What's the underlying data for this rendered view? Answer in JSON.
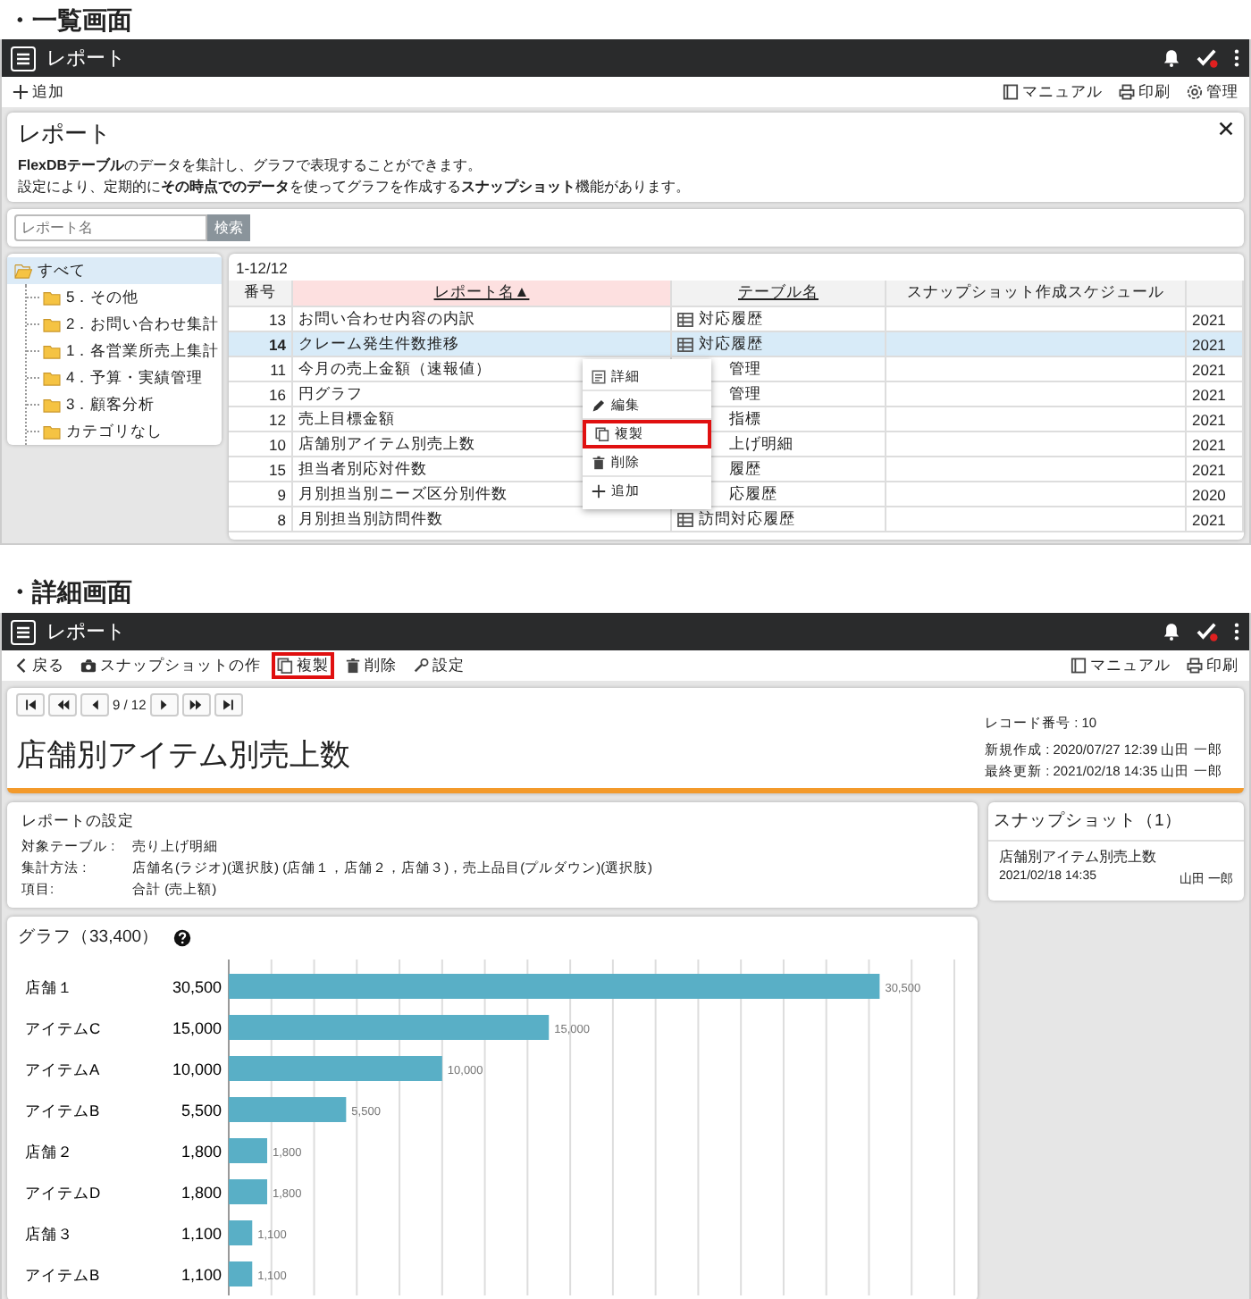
{
  "list_screen": {
    "section_heading": "・一覧画面",
    "app_bar": {
      "title": "レポート"
    },
    "toolbar": {
      "left": [
        {
          "kind": "add",
          "label": "追加"
        }
      ],
      "right": [
        {
          "kind": "manual",
          "label": "マニュアル"
        },
        {
          "kind": "print",
          "label": "印刷"
        },
        {
          "kind": "manage",
          "label": "管理"
        }
      ]
    },
    "info_card": {
      "title": "レポート",
      "lines": [
        "**FlexDBテーブル**のデータを集計し、グラフで表現することができます。",
        "設定により、定期的に**その時点でのデータ**を使ってグラフを作成する**スナップショット**機能があります。"
      ]
    },
    "search": {
      "placeholder": "レポート名",
      "button": "検索"
    },
    "tree": {
      "items": [
        {
          "label": "すべて",
          "selected": true,
          "children": [
            {
              "label": "5．その他",
              "selected": false
            },
            {
              "label": "2．お問い合わせ集計",
              "selected": false
            },
            {
              "label": "1．各営業所売上集計",
              "selected": false
            },
            {
              "label": "4．予算・実績管理",
              "selected": false
            },
            {
              "label": "3．顧客分析",
              "selected": false
            },
            {
              "label": "カテゴリなし",
              "selected": false
            }
          ]
        }
      ]
    },
    "table": {
      "count": "1-12/12",
      "columns": [
        {
          "label": "番号",
          "sorted": false
        },
        {
          "label": "レポート名▲",
          "sorted": true
        },
        {
          "label": "テーブル名",
          "sorted": false
        },
        {
          "label": "スナップショット作成スケジュール",
          "sorted": false
        }
      ],
      "rows": [
        {
          "number": "13",
          "name": "お問い合わせ内容の内訳",
          "table": "対応履歴",
          "covered": false,
          "column_5": "2021",
          "selected": false
        },
        {
          "number": "14",
          "name": "クレーム発生件数推移",
          "table": "対応履歴",
          "covered": false,
          "column_5": "2021",
          "selected": true
        },
        {
          "number": "11",
          "name": "今月の売上金額（速報値）",
          "table": "管理",
          "covered": true,
          "column_5": "2021",
          "selected": false
        },
        {
          "number": "16",
          "name": "円グラフ",
          "table": "管理",
          "covered": true,
          "column_5": "2021",
          "selected": false
        },
        {
          "number": "12",
          "name": "売上目標金額",
          "table": "指標",
          "covered": true,
          "column_5": "2021",
          "selected": false
        },
        {
          "number": "10",
          "name": "店舗別アイテム別売上数",
          "table": "上げ明細",
          "covered": true,
          "column_5": "2021",
          "selected": false
        },
        {
          "number": "15",
          "name": "担当者別応対件数",
          "table": "履歴",
          "covered": true,
          "column_5": "2021",
          "selected": false
        },
        {
          "number": "9",
          "name": "月別担当別ニーズ区分別件数",
          "table": "応履歴",
          "covered": true,
          "column_5": "2020",
          "selected": false
        },
        {
          "number": "8",
          "name": "月別担当別訪問件数",
          "table": "訪問対応履歴",
          "covered": false,
          "column_5": "2021",
          "selected": false
        }
      ]
    },
    "context_menu": {
      "items": [
        {
          "kind": "detail",
          "label": "詳細",
          "highlighted": false
        },
        {
          "kind": "edit",
          "label": "編集",
          "highlighted": false
        },
        {
          "kind": "copy",
          "label": "複製",
          "highlighted": true
        },
        {
          "kind": "delete",
          "label": "削除",
          "highlighted": false
        },
        {
          "kind": "add",
          "label": "追加",
          "highlighted": false
        }
      ]
    }
  },
  "detail_screen": {
    "section_heading": "・詳細画面",
    "app_bar": {
      "title": "レポート"
    },
    "toolbar": {
      "left": [
        {
          "kind": "back",
          "label": "戻る",
          "highlighted": false
        },
        {
          "kind": "snapshot",
          "label": "スナップショットの作",
          "highlighted": false
        },
        {
          "kind": "copy",
          "label": "複製",
          "highlighted": true
        },
        {
          "kind": "delete",
          "label": "削除",
          "highlighted": false
        },
        {
          "kind": "settings",
          "label": "設定",
          "highlighted": false
        }
      ],
      "right": [
        {
          "kind": "manual",
          "label": "マニュアル"
        },
        {
          "kind": "print",
          "label": "印刷"
        }
      ]
    },
    "pager": {
      "position": "9 / 12"
    },
    "record": {
      "title": "店舗別アイテム別売上数",
      "meta": [
        "レコード番号 : 10",
        "新規作成 : 2020/07/27 12:39 山田 一郎",
        "最終更新 : 2021/02/18 14:35 山田 一郎"
      ]
    },
    "settings": {
      "title": "レポートの設定",
      "fields": [
        {
          "label": "対象テーブル :",
          "value": "売り上げ明細"
        },
        {
          "label": "集計方法 :",
          "value": "店舗名(ラジオ)(選択肢) (店舗１，店舗２，店舗３)，売上品目(プルダウン)(選択肢)"
        },
        {
          "label": "項目:",
          "value": "合計 (売上額)"
        }
      ]
    },
    "graph": {
      "title": "グラフ（33,400）",
      "row_totals": [
        "30,500",
        "15,000",
        "10,000",
        "5,500",
        "1,800",
        "1,800",
        "1,100",
        "1,100"
      ],
      "chart_data": {
        "type": "bar",
        "orientation": "horizontal",
        "categories": [
          "店舗１",
          "アイテムC",
          "アイテムA",
          "アイテムB",
          "店舗２",
          "アイテムD",
          "店舗３",
          "アイテムB"
        ],
        "values": [
          30500,
          15000,
          10000,
          5500,
          1800,
          1800,
          1100,
          1100
        ],
        "value_labels": [
          "30,500",
          "15,000",
          "10,000",
          "5,500",
          "1,800",
          "1,800",
          "1,100",
          "1,100"
        ],
        "xlim": [
          0,
          34000
        ]
      }
    },
    "snapshots": {
      "title": "スナップショット（1）",
      "items": [
        {
          "name": "店舗別アイテム別売上数",
          "date": "2021/02/18 14:35",
          "user": "山田 一郎"
        }
      ]
    }
  }
}
